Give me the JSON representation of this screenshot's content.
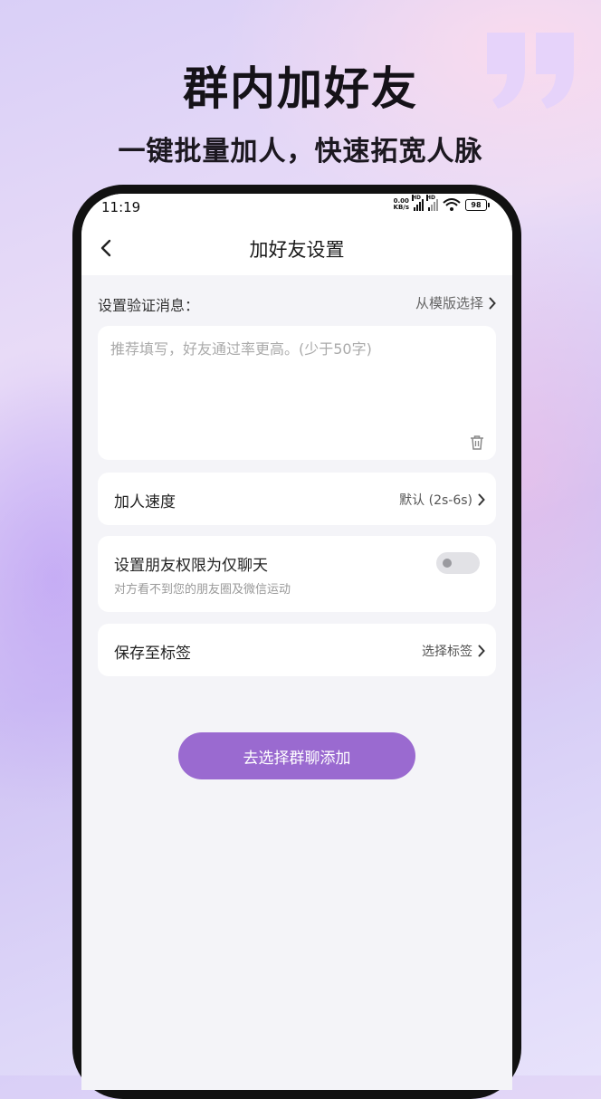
{
  "promo": {
    "headline": "群内加好友",
    "subline": "一键批量加人，快速拓宽人脉"
  },
  "status_bar": {
    "time": "11:19",
    "net_speed_value": "0.00",
    "net_speed_unit": "KB/s",
    "signal_1_tag": "HD",
    "signal_2_tag": "HD",
    "battery": "98"
  },
  "nav": {
    "title": "加好友设置"
  },
  "verify": {
    "label": "设置验证消息：",
    "template_link": "从模版选择",
    "placeholder": "推荐填写，好友通过率更高。(少于50字)"
  },
  "speed": {
    "title": "加人速度",
    "value": "默认 (2s-6s)"
  },
  "privacy": {
    "title": "设置朋友权限为仅聊天",
    "subtitle": "对方看不到您的朋友圈及微信运动",
    "enabled": false
  },
  "tag": {
    "title": "保存至标签",
    "value": "选择标签"
  },
  "action": {
    "button_label": "去选择群聊添加"
  },
  "colors": {
    "accent": "#9a6ad0",
    "quote": "#e2cdf7"
  },
  "icons": [
    "back-chevron-icon",
    "chevron-right-icon",
    "trash-icon",
    "quote-icon",
    "wifi-icon",
    "signal-icon",
    "battery-icon"
  ]
}
